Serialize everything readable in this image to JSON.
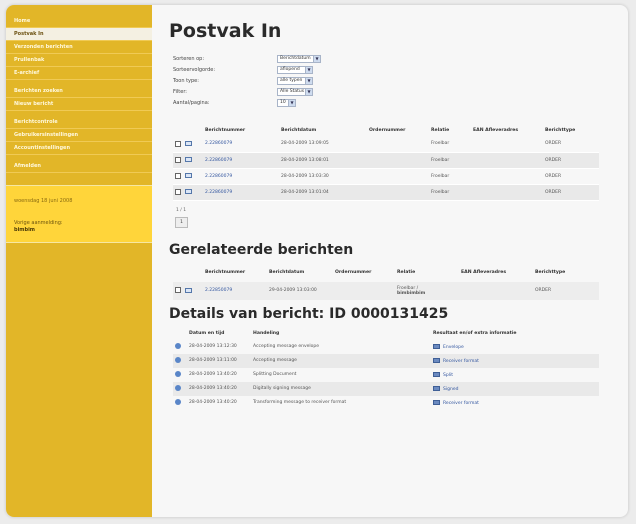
{
  "sidebar": {
    "items": [
      {
        "label": "Home"
      },
      {
        "label": "Postvak In"
      },
      {
        "label": "Verzonden berichten"
      },
      {
        "label": "Prullenbak"
      },
      {
        "label": "E-archief"
      },
      {
        "label": "Berichten zoeken"
      },
      {
        "label": "Nieuw bericht"
      },
      {
        "label": "Berichtcontrole"
      },
      {
        "label": "Gebruikersinstellingen"
      },
      {
        "label": "Accountinstellingen"
      },
      {
        "label": "Afmelden"
      }
    ],
    "date": "woensdag 18 juni 2008",
    "last_login_label": "Vorige aanmelding:",
    "last_login_user": "bimbim"
  },
  "title": "Postvak In",
  "filters": [
    {
      "label": "Sorteren op:",
      "value": "Berichtdatum"
    },
    {
      "label": "Sorteervolgorde:",
      "value": "aflopend"
    },
    {
      "label": "Toon type:",
      "value": "alle typen"
    },
    {
      "label": "Filter:",
      "value": "Alle Status"
    },
    {
      "label": "Aantal/pagina:",
      "value": "10"
    }
  ],
  "messages": {
    "headers": [
      "Berichtnummer",
      "Berichtdatum",
      "Ordernummer",
      "Relatie",
      "EAN Afleveradres",
      "Berichttype"
    ],
    "rows": [
      {
        "nummer": "2.22860079",
        "datum": "28-04-2009 13:09:05",
        "order": "",
        "relatie": "Froelbar",
        "ean": "",
        "type": "ORDER"
      },
      {
        "nummer": "2.22860079",
        "datum": "28-04-2009 13:08:01",
        "order": "",
        "relatie": "Froelbar",
        "ean": "",
        "type": "ORDER"
      },
      {
        "nummer": "2.22860079",
        "datum": "28-04-2009 13:03:30",
        "order": "",
        "relatie": "Froelbar",
        "ean": "",
        "type": "ORDER"
      },
      {
        "nummer": "2.22860079",
        "datum": "28-04-2009 13:01:04",
        "order": "",
        "relatie": "Froelbar",
        "ean": "",
        "type": "ORDER"
      }
    ],
    "pager_text": "1 / 1",
    "pager_button": "1"
  },
  "related": {
    "title": "Gerelateerde berichten",
    "headers": [
      "Berichtnummer",
      "Berichtdatum",
      "Ordernummer",
      "Relatie",
      "EAN Afleveradres",
      "Berichttype"
    ],
    "rows": [
      {
        "nummer": "2.22850079",
        "datum": "29-04-2009 13:03:00",
        "order": "",
        "relatie": "Froelbar /",
        "relatie2": "bimbimbim",
        "ean": "",
        "type": "ORDER"
      }
    ]
  },
  "details": {
    "title": "Details van bericht: ID 0000131425",
    "headers": [
      "Datum en tijd",
      "Handeling",
      "Resultaat en/of extra informatie"
    ],
    "rows": [
      {
        "tijd": "28-04-2009 13:12:30",
        "handeling": "Accepting message envelope",
        "resultaat": "Envelope"
      },
      {
        "tijd": "28-04-2009 13:11:00",
        "handeling": "Accepting message",
        "resultaat": "Receiver format"
      },
      {
        "tijd": "28-04-2009 13:40:20",
        "handeling": "Splitting Document",
        "resultaat": "Split"
      },
      {
        "tijd": "28-04-2009 13:40:20",
        "handeling": "Digitally signing message",
        "resultaat": "Signed"
      },
      {
        "tijd": "28-04-2009 13:40:20",
        "handeling": "Transforming message to receiver format",
        "resultaat": "Receiver format"
      }
    ]
  }
}
